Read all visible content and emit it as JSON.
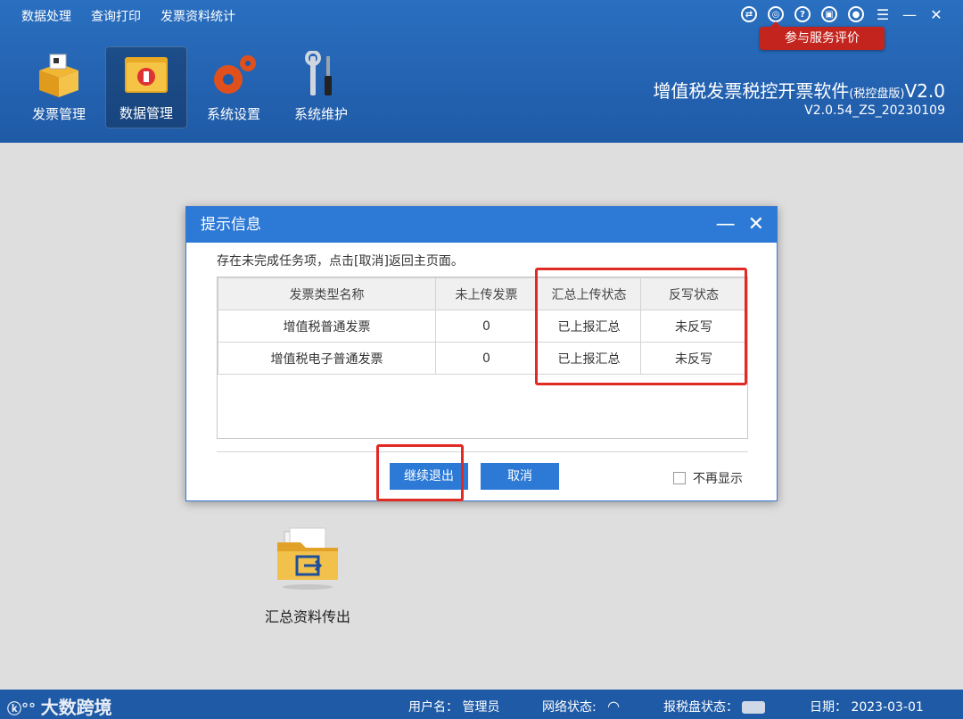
{
  "menu": [
    "数据处理",
    "查询打印",
    "发票资料统计"
  ],
  "eval_button": "参与服务评价",
  "toolbar": [
    {
      "label": "发票管理",
      "active": false
    },
    {
      "label": "数据管理",
      "active": true
    },
    {
      "label": "系统设置",
      "active": false
    },
    {
      "label": "系统维护",
      "active": false
    }
  ],
  "app": {
    "title": "增值税发票税控开票软件",
    "edition": "(税控盘版)",
    "title_suffix": "V2.0",
    "version": "V2.0.54_ZS_20230109"
  },
  "main": {
    "folder_label": "汇总资料传出"
  },
  "dialog": {
    "title": "提示信息",
    "message": "存在未完成任务项，点击[取消]返回主页面。",
    "columns": [
      "发票类型名称",
      "未上传发票",
      "汇总上传状态",
      "反写状态"
    ],
    "rows": [
      [
        "增值税普通发票",
        "0",
        "已上报汇总",
        "未反写"
      ],
      [
        "增值税电子普通发票",
        "0",
        "已上报汇总",
        "未反写"
      ]
    ],
    "continue_button": "继续退出",
    "cancel_button": "取消",
    "checkbox_label": "不再显示"
  },
  "status": {
    "brand": "大数跨境",
    "user_label": "用户名：",
    "user_value": "管理员",
    "network_label": "网络状态:",
    "disk_label": "报税盘状态：",
    "date_label": "日期：",
    "date_value": "2023-03-01"
  },
  "colors": {
    "header": "#1f5aa6",
    "accent": "#2d7ad6",
    "highlight": "#e02a24",
    "eval": "#c3241d"
  }
}
